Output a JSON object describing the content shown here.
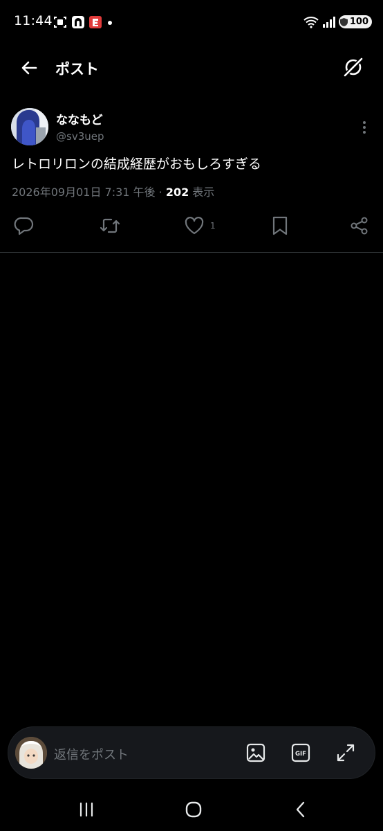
{
  "status_bar": {
    "time": "11:44",
    "battery": "100",
    "icons": [
      "screenshot-icon",
      "app-icon",
      "app-badge-icon",
      "wifi-icon",
      "signal-icon",
      "battery-icon"
    ]
  },
  "header": {
    "title": "ポスト",
    "back_icon": "arrow-left-icon",
    "grok_icon": "grok-icon"
  },
  "post": {
    "display_name": "ななもど",
    "handle": "@sv3uep",
    "text": "レトロリロンの結成経歴がおもしろすぎる",
    "timestamp": "2026年09月01日 7:31 午後",
    "separator": " · ",
    "views_count": "202",
    "views_label": " 表示",
    "like_count": "1",
    "actions": [
      "reply-icon",
      "retweet-icon",
      "like-icon",
      "bookmark-icon",
      "share-icon"
    ]
  },
  "reply_bar": {
    "placeholder": "返信をポスト",
    "icons": [
      "image-icon",
      "gif-icon",
      "expand-icon"
    ]
  },
  "nav_bar": {
    "icons": [
      "recents-icon",
      "home-icon",
      "back-icon"
    ]
  },
  "colors": {
    "background": "#000000",
    "text": "#e7e9ea",
    "secondary": "#71767b",
    "divider": "#2f3336"
  }
}
